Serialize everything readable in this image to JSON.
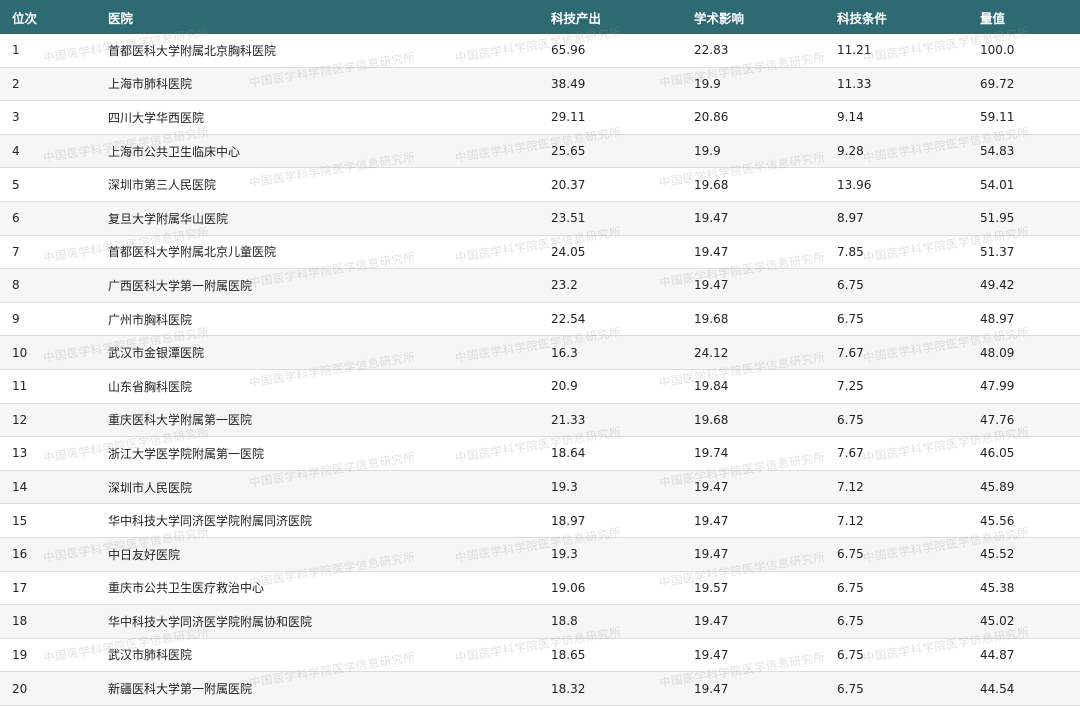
{
  "table": {
    "headers": [
      "位次",
      "医院",
      "科技产出",
      "学术影响",
      "科技条件",
      "量值"
    ],
    "rows": [
      [
        "1",
        "首都医科大学附属北京胸科医院",
        "65.96",
        "22.83",
        "11.21",
        "100.0"
      ],
      [
        "2",
        "上海市肺科医院",
        "38.49",
        "19.9",
        "11.33",
        "69.72"
      ],
      [
        "3",
        "四川大学华西医院",
        "29.11",
        "20.86",
        "9.14",
        "59.11"
      ],
      [
        "4",
        "上海市公共卫生临床中心",
        "25.65",
        "19.9",
        "9.28",
        "54.83"
      ],
      [
        "5",
        "深圳市第三人民医院",
        "20.37",
        "19.68",
        "13.96",
        "54.01"
      ],
      [
        "6",
        "复旦大学附属华山医院",
        "23.51",
        "19.47",
        "8.97",
        "51.95"
      ],
      [
        "7",
        "首都医科大学附属北京儿童医院",
        "24.05",
        "19.47",
        "7.85",
        "51.37"
      ],
      [
        "8",
        "广西医科大学第一附属医院",
        "23.2",
        "19.47",
        "6.75",
        "49.42"
      ],
      [
        "9",
        "广州市胸科医院",
        "22.54",
        "19.68",
        "6.75",
        "48.97"
      ],
      [
        "10",
        "武汉市金银潭医院",
        "16.3",
        "24.12",
        "7.67",
        "48.09"
      ],
      [
        "11",
        "山东省胸科医院",
        "20.9",
        "19.84",
        "7.25",
        "47.99"
      ],
      [
        "12",
        "重庆医科大学附属第一医院",
        "21.33",
        "19.68",
        "6.75",
        "47.76"
      ],
      [
        "13",
        "浙江大学医学院附属第一医院",
        "18.64",
        "19.74",
        "7.67",
        "46.05"
      ],
      [
        "14",
        "深圳市人民医院",
        "19.3",
        "19.47",
        "7.12",
        "45.89"
      ],
      [
        "15",
        "华中科技大学同济医学院附属同济医院",
        "18.97",
        "19.47",
        "7.12",
        "45.56"
      ],
      [
        "16",
        "中日友好医院",
        "19.3",
        "19.47",
        "6.75",
        "45.52"
      ],
      [
        "17",
        "重庆市公共卫生医疗救治中心",
        "19.06",
        "19.57",
        "6.75",
        "45.38"
      ],
      [
        "18",
        "华中科技大学同济医学院附属协和医院",
        "18.8",
        "19.47",
        "6.75",
        "45.02"
      ],
      [
        "19",
        "武汉市肺科医院",
        "18.65",
        "19.47",
        "6.75",
        "44.87"
      ],
      [
        "20",
        "新疆医科大学第一附属医院",
        "18.32",
        "19.47",
        "6.75",
        "44.54"
      ]
    ]
  },
  "watermark": {
    "text": "中国医学科学院医学信息研究所"
  },
  "colors": {
    "header_bg": "#2e6a72",
    "header_text": "#ffffff",
    "row_alt_bg": "#f6f6f6",
    "row_border": "#dcdcdc"
  }
}
